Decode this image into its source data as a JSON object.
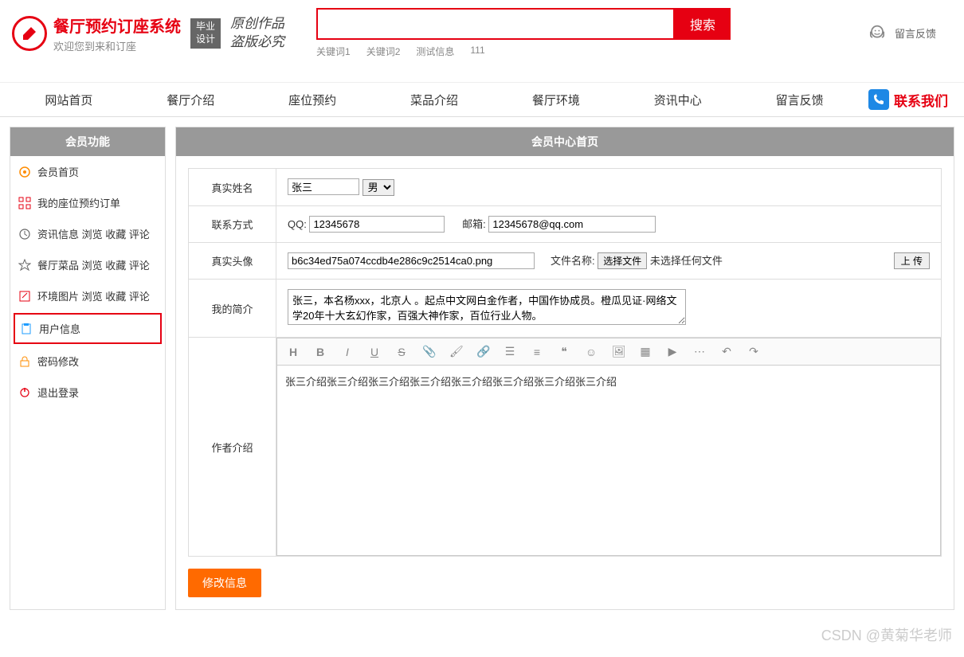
{
  "header": {
    "site_title": "餐厅预约订座系统",
    "site_sub": "欢迎您到来和订座",
    "badge_line1": "毕业",
    "badge_line2": "设计",
    "slogan_line1": "原创作品",
    "slogan_line2": "盗版必究",
    "search_btn": "搜索",
    "keywords": [
      "关键词1",
      "关键词2",
      "测试信息",
      "111"
    ],
    "feedback": "留言反馈"
  },
  "nav": {
    "items": [
      "网站首页",
      "餐厅介绍",
      "座位预约",
      "菜品介绍",
      "餐厅环境",
      "资讯中心",
      "留言反馈"
    ],
    "contact": "联系我们"
  },
  "sidebar": {
    "title": "会员功能",
    "items": [
      {
        "label": "会员首页"
      },
      {
        "label": "我的座位预约订单"
      },
      {
        "label": "资讯信息 浏览 收藏 评论"
      },
      {
        "label": "餐厅菜品 浏览 收藏 评论"
      },
      {
        "label": "环境图片 浏览 收藏 评论"
      },
      {
        "label": "用户信息"
      },
      {
        "label": "密码修改"
      },
      {
        "label": "退出登录"
      }
    ]
  },
  "content": {
    "title": "会员中心首页",
    "labels": {
      "realname": "真实姓名",
      "contact": "联系方式",
      "avatar": "真实头像",
      "intro": "我的简介",
      "author": "作者介绍"
    },
    "values": {
      "name": "张三",
      "gender": "男",
      "qq_label": "QQ: ",
      "qq": "12345678",
      "email_label": "邮箱: ",
      "email": "12345678@qq.com",
      "avatar_file": "b6c34ed75a074ccdb4e286c9c2514ca0.png",
      "file_label": "文件名称:",
      "choose_file": "选择文件",
      "no_file": "未选择任何文件",
      "upload": "上 传",
      "intro_text": "张三，本名杨xxx，北京人 。起点中文网白金作者，中国作协成员。橙瓜见证·网络文学20年十大玄幻作家，百强大神作家，百位行业人物。",
      "author_text": "张三介绍张三介绍张三介绍张三介绍张三介绍张三介绍张三介绍张三介绍"
    },
    "submit": "修改信息"
  },
  "watermark": "CSDN @黄菊华老师"
}
